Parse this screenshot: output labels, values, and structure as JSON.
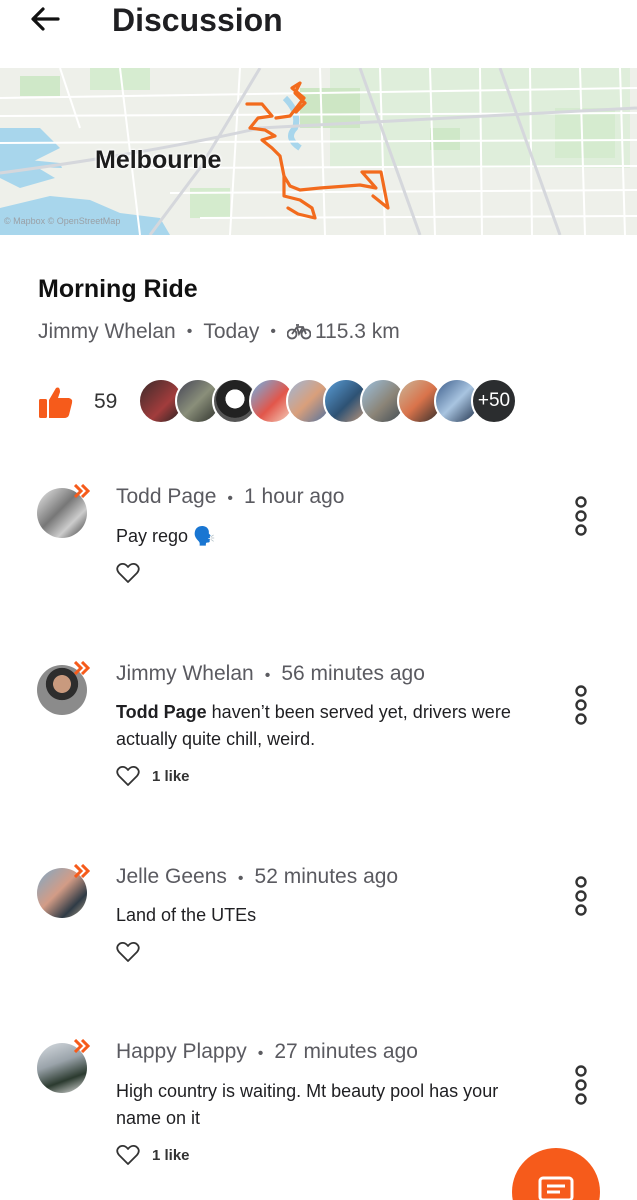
{
  "header": {
    "title": "Discussion",
    "back_icon": "arrow-left-icon"
  },
  "map": {
    "city_label": "Melbourne",
    "attribution": "© Mapbox © OpenStreetMap",
    "route_color": "#f26b1d"
  },
  "activity": {
    "title": "Morning Ride",
    "athlete": "Jimmy Whelan",
    "date": "Today",
    "sport_icon": "bike-icon",
    "distance": "115.3 km",
    "kudos_count": "59",
    "more_kudos": "+50",
    "accent": "#f65b1b"
  },
  "comments": [
    {
      "author": "Todd Page",
      "time": "1 hour ago",
      "text": "Pay rego 🗣️",
      "likes": ""
    },
    {
      "author": "Jimmy Whelan",
      "time": "56 minutes ago",
      "mention": "Todd Page",
      "text": " haven’t been served yet, drivers were actually quite chill, weird.",
      "likes": "1 like"
    },
    {
      "author": "Jelle Geens",
      "time": "52 minutes ago",
      "text": "Land of the UTEs",
      "likes": ""
    },
    {
      "author": "Happy Plappy",
      "time": "27 minutes ago",
      "text": "High country is waiting. Mt beauty pool has your name on it",
      "likes": "1 like"
    }
  ]
}
